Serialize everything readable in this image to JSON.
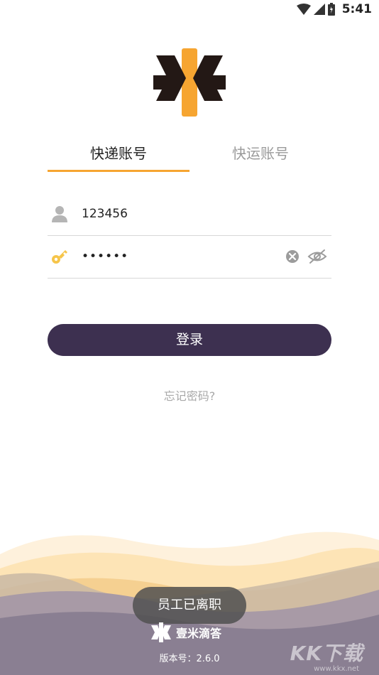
{
  "status_bar": {
    "time": "5:41",
    "icons": [
      "wifi-icon",
      "signal-icon",
      "battery-icon"
    ]
  },
  "tabs": [
    {
      "label": "快递账号",
      "active": true
    },
    {
      "label": "快运账号",
      "active": false
    }
  ],
  "form": {
    "username_value": "123456",
    "password_value": "••••••"
  },
  "login_label": "登录",
  "forgot_label": "忘记密码?",
  "toast": "员工已离职",
  "brand_name": "壹米滴答",
  "version": "版本号：2.6.0",
  "watermark": "KK下载",
  "watermark_url": "www.kkx.net",
  "colors": {
    "accent": "#f6a531",
    "button": "#3d3050",
    "wave_dark": "#8a7f92",
    "wave_light": "#fde7c2"
  }
}
